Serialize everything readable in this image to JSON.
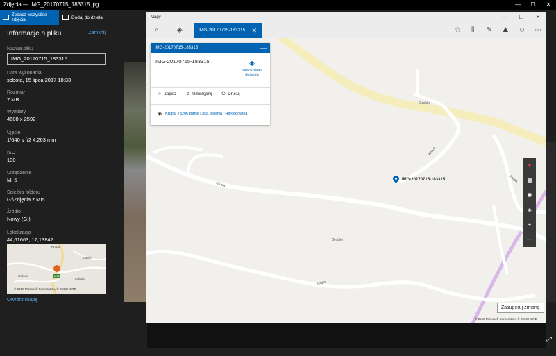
{
  "app": {
    "title": "Zdjęcia — IMG_20170715_183315.jpg",
    "window_controls": [
      "—",
      "☐",
      "✕"
    ]
  },
  "photos_toolbar": {
    "see_all_label": "Zobacz wszystkie zdjęcia",
    "add_to_project_label": "Dodaj do dzieła"
  },
  "info": {
    "title": "Informacje o pliku",
    "close_label": "Zamknij",
    "fields": {
      "file_name": {
        "label": "Nazwa pliku",
        "value": "IMG_20170715_183315"
      },
      "date_taken": {
        "label": "Data wykonania",
        "value": "sobota, 15 lipca 2017 18:33"
      },
      "size": {
        "label": "Rozmiar",
        "value": "7 MB"
      },
      "dimensions": {
        "label": "Wymiary",
        "value": "4608 x 2592"
      },
      "exposure": {
        "label": "Ujęcie",
        "value": "1/640 s f/2 4,263 mm"
      },
      "iso": {
        "label": "ISO",
        "value": "100"
      },
      "device": {
        "label": "Urządzenie",
        "value": "MI 5"
      },
      "folder_path": {
        "label": "Ścieżka folderu",
        "value": "G:\\Zdjęcia z MI5"
      },
      "source": {
        "label": "Źródło",
        "value": "Nowy (G:)"
      },
      "location": {
        "label": "Lokalizacja",
        "value": "44,61663; 17,13842"
      }
    },
    "minimap": {
      "copyright": "© 2018 Microsoft Corporation, © 2018 HERE",
      "labels": [
        "Krupa",
        "Lakici",
        "Gelovci",
        "Lukajici",
        "M15"
      ]
    },
    "open_map_label": "Otwórz mapę"
  },
  "maps": {
    "window_title": "Mapy",
    "window_controls": [
      "—",
      "☐",
      "✕"
    ],
    "search_tab_label": "IMG-20170715-183315",
    "card": {
      "header": "IMG-20170715-183315",
      "title": "IMG-20170715-183315",
      "directions_label": "Wskazówki dojazdu",
      "actions": {
        "save": "Zapisz",
        "share": "Udostępnij",
        "print": "Drukuj"
      },
      "address": "Krupa, 78206 Banja Luka, Bośnia i Hercegowina"
    },
    "pin_label": "IMG-20170715-183315",
    "road_labels": {
      "grobije_1": "Grobije",
      "grobije_2": "Grobije",
      "krupa_1": "Krupa",
      "krupa_2": "Krupa",
      "krupa_3": "Krupa",
      "krupa_4": "Krupa"
    },
    "suggest_change_label": "Zasugeruj zmianę",
    "copyright": "© 2018 Microsoft Corporation, © 2018 HERE"
  },
  "colors": {
    "accent": "#0063b1",
    "link": "#5aa6e8",
    "panel_bg": "#1f1f1f"
  }
}
